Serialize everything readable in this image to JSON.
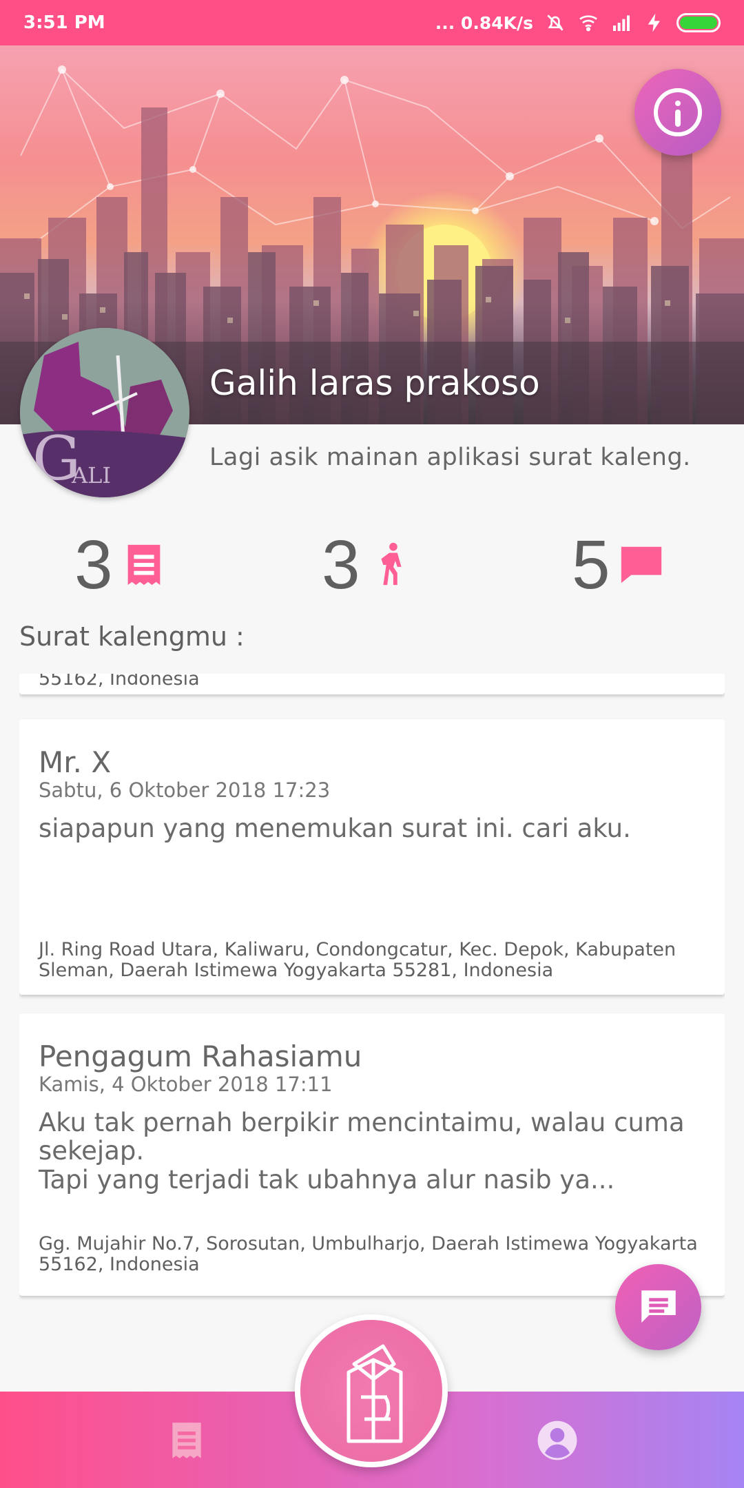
{
  "status_bar": {
    "time": "3:51 PM",
    "network_speed": "... 0.84K/s",
    "icons": [
      "mute-icon",
      "wifi-icon",
      "signal-icon",
      "charging-icon",
      "battery-icon"
    ]
  },
  "profile": {
    "name": "Galih laras prakoso",
    "bio": "Lagi asik mainan aplikasi surat kaleng.",
    "avatar_icon": "avatar-violin-logo-icon"
  },
  "stats": [
    {
      "value": "3",
      "icon": "letter-icon"
    },
    {
      "value": "3",
      "icon": "walking-person-icon"
    },
    {
      "value": "5",
      "icon": "chat-bubble-icon"
    }
  ],
  "letters_title": "Surat kalengmu :",
  "letters": [
    {
      "address": "55162, Indonesia"
    },
    {
      "sender": "Mr. X",
      "date": "Sabtu, 6 Oktober 2018 17:23",
      "message": "siapapun yang menemukan surat ini. cari aku.",
      "address": "Jl. Ring Road Utara, Kaliwaru, Condongcatur, Kec. Depok, Kabupaten Sleman, Daerah Istimewa Yogyakarta 55281, Indonesia"
    },
    {
      "sender": "Pengagum Rahasiamu",
      "date": "Kamis, 4 Oktober 2018 17:11",
      "message": "Aku tak pernah berpikir mencintaimu, walau cuma sekejap.\nTapi yang terjadi tak ubahnya alur nasib ya...",
      "address": "Gg. Mujahir No.7, Sorosutan, Umbulharjo, Daerah Istimewa Yogyakarta 55162, Indonesia"
    }
  ],
  "colors": {
    "status_bar": "#ff4f86",
    "accent_pink": "#ff5c93",
    "fab_start": "#f060b5",
    "fab_end": "#bf61c5",
    "nav_start": "#ff4f8a",
    "nav_end": "#a684f3"
  },
  "nav": {
    "items": [
      "letters-nav-icon",
      "profile-nav-icon"
    ],
    "center_icon": "bottle-icon",
    "info_icon": "info-icon",
    "chat_fab_icon": "chat-icon"
  }
}
